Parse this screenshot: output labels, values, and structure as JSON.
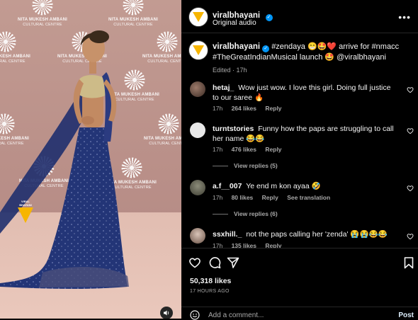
{
  "post": {
    "username": "viralbhayani",
    "audio": "Original audio",
    "caption_parts": [
      {
        "text": "#zendaya 😁🤩❤️ arrive for #nmacc #TheGreatIndianMusical launch 🤩 @viralbhayani"
      }
    ],
    "edited": "Edited · 17h",
    "likes": "50,318 likes",
    "time_ago": "17 HOURS AGO"
  },
  "media": {
    "backdrop_brand_line1": "NITA MUKESH AMBANI",
    "backdrop_brand_line2": "CULTURAL CENTRE",
    "watermark": "VIRAL BHAYANI"
  },
  "comments": [
    {
      "user": "hetaj_",
      "text": "Wow just wow. I love this girl. Doing full justice to our saree 🔥",
      "time": "17h",
      "likes": "264 likes",
      "reply": "Reply"
    },
    {
      "user": "turntstories",
      "text": "Funny how the paps are struggling to call her name 😂😂",
      "time": "17h",
      "likes": "476 likes",
      "reply": "Reply",
      "view_replies": "View replies (5)"
    },
    {
      "user": "a.f__007",
      "text": "Ye end m kon ayaa 🤣",
      "time": "17h",
      "likes": "80 likes",
      "reply": "Reply",
      "translate": "See translation",
      "view_replies": "View replies (6)"
    },
    {
      "user": "ssxhill._",
      "text": "not the paps calling her 'zenda' 😭😭😂😂",
      "time": "17h",
      "likes": "135 likes",
      "reply": "Reply"
    }
  ],
  "add_comment": {
    "placeholder": "Add a comment...",
    "post_label": "Post"
  },
  "colors": {
    "accent_blue": "#0095f6",
    "brand_yellow": "#f7b500",
    "backdrop": "#c29b92"
  },
  "icons": [
    "verified-badge-icon",
    "more-options-icon",
    "heart-icon",
    "comment-icon",
    "share-icon",
    "bookmark-icon",
    "emoji-icon",
    "volume-icon"
  ]
}
